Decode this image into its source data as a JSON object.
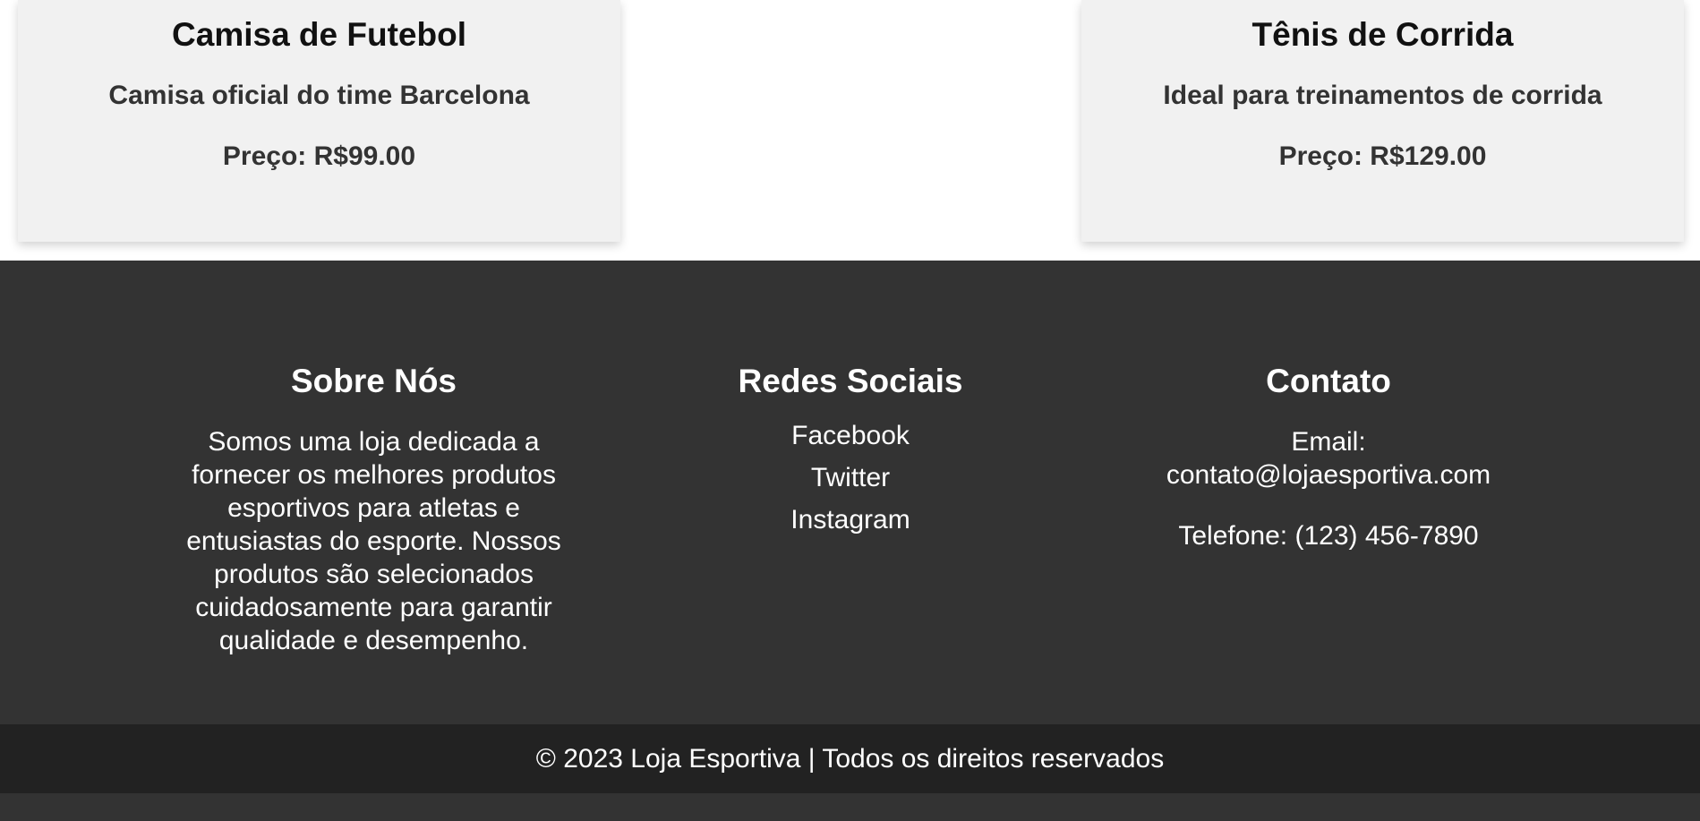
{
  "products": [
    {
      "name": "Camisa de Futebol",
      "description": "Camisa oficial do time Barcelona",
      "price": "Preço: R$99.00"
    },
    {
      "name": "Tênis de Corrida",
      "description": "Ideal para treinamentos de corrida",
      "price": "Preço: R$129.00"
    }
  ],
  "footer": {
    "about": {
      "heading": "Sobre Nós",
      "text": "Somos uma loja dedicada a fornecer os melhores produtos esportivos para atletas e entusiastas do esporte. Nossos produtos são selecionados cuidadosamente para garantir qualidade e desempenho."
    },
    "social": {
      "heading": "Redes Sociais",
      "links": [
        "Facebook",
        "Twitter",
        "Instagram"
      ]
    },
    "contact": {
      "heading": "Contato",
      "email": "Email: contato@lojaesportiva.com",
      "phone": "Telefone: (123) 456-7890"
    },
    "copyright": "© 2023 Loja Esportiva | Todos os direitos reservados"
  },
  "colors": {
    "card_background": "#f1f1f1",
    "footer_background": "#333333",
    "copyright_background": "#222222",
    "footer_text": "#ffffff"
  }
}
